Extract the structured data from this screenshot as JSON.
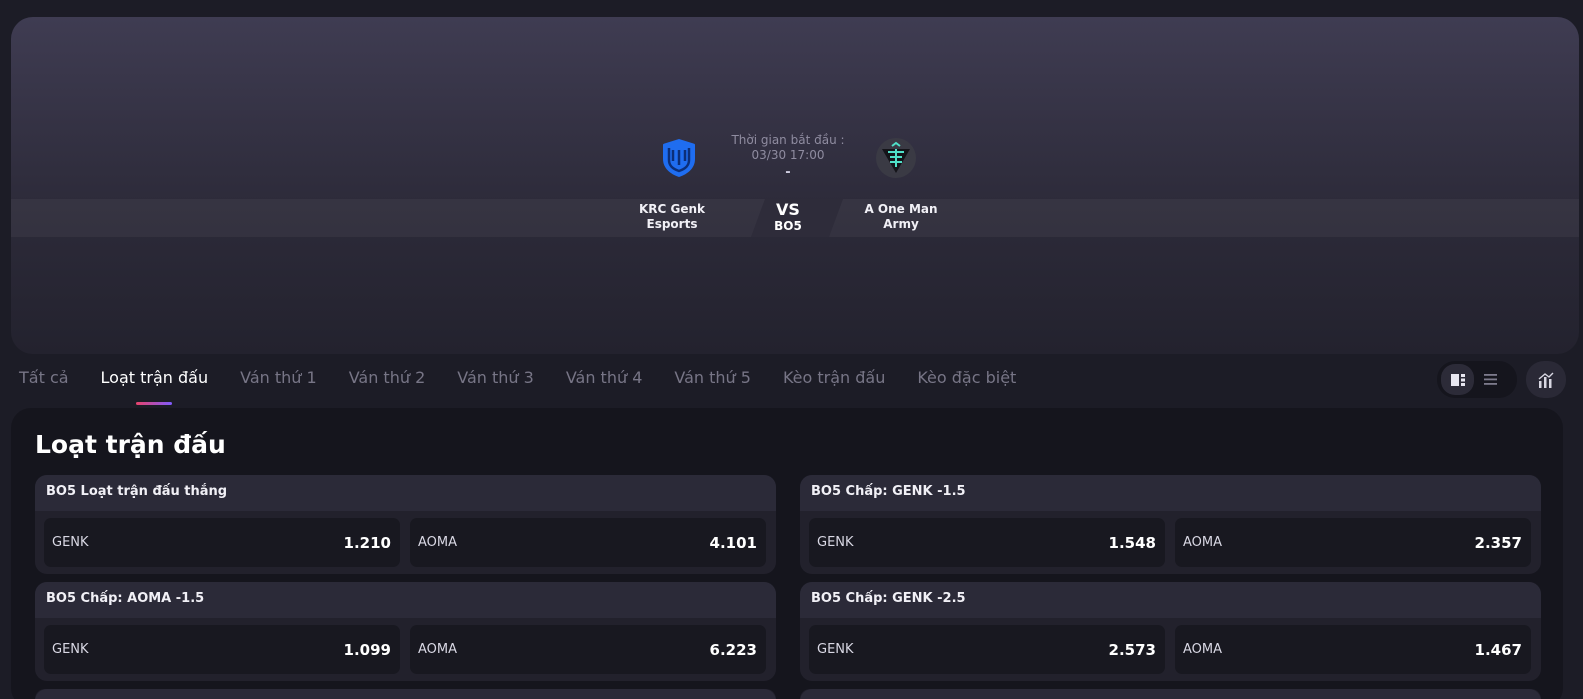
{
  "match": {
    "start_label": "Thời gian bắt đầu :",
    "start_time": "03/30 17:00",
    "score": "-",
    "vs": "VS",
    "format": "BO5",
    "team_left": {
      "line1": "KRC Genk",
      "line2": "Esports"
    },
    "team_right": {
      "line1": "A One Man",
      "line2": "Army"
    }
  },
  "tabs": [
    {
      "label": "Tất cả"
    },
    {
      "label": "Loạt trận đấu"
    },
    {
      "label": "Ván thứ 1"
    },
    {
      "label": "Ván thứ 2"
    },
    {
      "label": "Ván thứ 3"
    },
    {
      "label": "Ván thứ 4"
    },
    {
      "label": "Ván thứ 5"
    },
    {
      "label": "Kèo trận đấu"
    },
    {
      "label": "Kèo đặc biệt"
    }
  ],
  "section": {
    "title": "Loạt trận đấu"
  },
  "markets": [
    {
      "title": "BO5 Loạt trận đấu thắng",
      "left_team": "GENK",
      "left_odd": "1.210",
      "right_team": "AOMA",
      "right_odd": "4.101"
    },
    {
      "title": "BO5 Chấp: GENK -1.5",
      "left_team": "GENK",
      "left_odd": "1.548",
      "right_team": "AOMA",
      "right_odd": "2.357"
    },
    {
      "title": "BO5 Chấp: AOMA -1.5",
      "left_team": "GENK",
      "left_odd": "1.099",
      "right_team": "AOMA",
      "right_odd": "6.223"
    },
    {
      "title": "BO5 Chấp: GENK -2.5",
      "left_team": "GENK",
      "left_odd": "2.573",
      "right_team": "AOMA",
      "right_odd": "1.467"
    }
  ],
  "colors": {
    "accent_start": "#e8436b",
    "accent_end": "#7f5bff",
    "genk_blue": "#1f6df0",
    "aoma_teal": "#4fe0c8"
  },
  "icons": {
    "view_grid": "split-view-icon",
    "view_list": "list-view-icon",
    "chart": "bar-chart-icon"
  }
}
